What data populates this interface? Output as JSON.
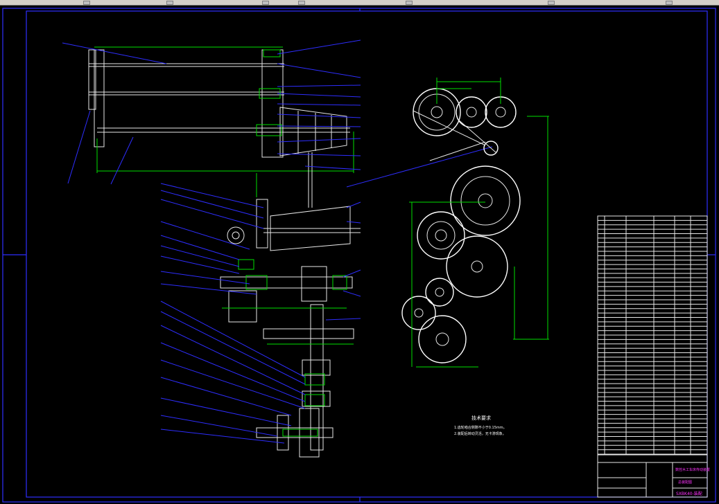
{
  "drawing": {
    "tech_title": "技术要求",
    "tech_notes": [
      "1.齿轮啮合侧隙不小于0.15mm。",
      "2.装配后转动灵活，无卡滞现象。"
    ],
    "title_block": {
      "name_line1": "数控木工车床传动装置",
      "name_line2": "总装配图",
      "code": "SXBK40-装配"
    }
  },
  "colors": {
    "background": "#000000",
    "geometry": "#ffffff",
    "dimension": "#00e000",
    "leader_and_frame": "#2e2eff",
    "title_accent": "#ff33ff"
  }
}
